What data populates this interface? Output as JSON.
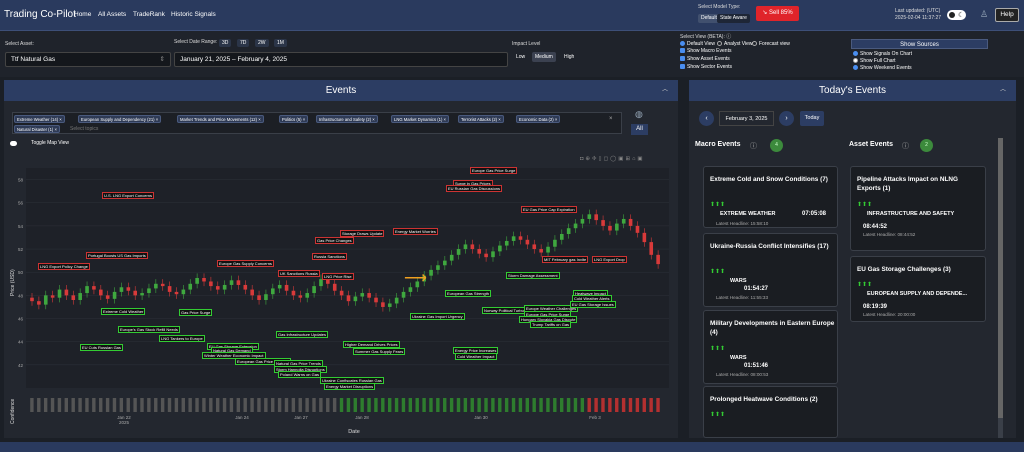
{
  "header": {
    "app_title": "Trading Co-Pilot",
    "nav": [
      "Home",
      "All Assets",
      "TradeRank",
      "Historic Signals"
    ],
    "model_label": "Select Model Type:",
    "model_default": "Default",
    "model_state": "State Aware",
    "sell_label": "Sell 85%",
    "updated_label": "Last updated: (UTC)",
    "updated_time": "2025-02-04 11:37:27",
    "help": "Help"
  },
  "controls": {
    "asset_label": "Select Asset:",
    "asset_value": "Ttf Natural Gas",
    "range_label": "Select Date Range:",
    "range_buttons": [
      "3D",
      "7D",
      "2W",
      "1M"
    ],
    "range_value": "January 21, 2025 – February 4, 2025",
    "impact_label": "Impact Level",
    "impact_options": [
      "Low",
      "Medium",
      "High"
    ],
    "view_label": "Select View (BETA):",
    "views": [
      "Default View",
      "Analyst View",
      "Forecast view"
    ],
    "show_checks": [
      "Show Macro Events",
      "Show Asset Events",
      "Show Sector Events"
    ],
    "sources_btn": "Show Sources",
    "source_opts": [
      "Show Signals On Chart",
      "Show Full Chart",
      "Show Weekend Events"
    ]
  },
  "events_panel": {
    "title": "Events",
    "all_btn": "All",
    "placeholder": "Select topics",
    "toggle_label": "Toggle Map View",
    "tags": [
      "Extreme Weather (14)",
      "European Supply and Dependency (21)",
      "Market Trends and Price Movements (12)",
      "Politics (5)",
      "Infrastructure and Safety (2)",
      "LNG Market Dynamics (1)",
      "Terrorist Attacks (2)",
      "Economic Data (2)",
      "Natural Disaster (1)"
    ]
  },
  "chart_data": {
    "type": "candlestick",
    "xlabel": "Date",
    "ylabel": "Price (USD)",
    "ylabel2": "Confidence",
    "x_ticks": [
      "Jan 22\n2025",
      "Jan 24",
      "Jan 27",
      "Jan 28",
      "Jan 30",
      "Feb 3"
    ],
    "y_ticks": [
      "58",
      "56",
      "54",
      "52",
      "50",
      "48",
      "46",
      "44",
      "42"
    ],
    "close": [
      47.5,
      47.2,
      48.0,
      47.8,
      48.5,
      48.0,
      47.6,
      48.2,
      48.8,
      48.5,
      48.0,
      47.7,
      48.3,
      48.7,
      48.4,
      48.0,
      48.2,
      48.6,
      49.0,
      48.8,
      48.3,
      48.1,
      48.5,
      49.0,
      49.5,
      49.2,
      48.8,
      48.5,
      48.9,
      49.3,
      48.9,
      48.5,
      48.0,
      47.6,
      48.1,
      48.6,
      48.9,
      48.4,
      48.0,
      47.8,
      48.2,
      48.8,
      49.4,
      49.0,
      48.4,
      48.0,
      47.5,
      47.9,
      48.2,
      47.8,
      47.4,
      47.0,
      47.3,
      47.8,
      48.3,
      48.7,
      49.2,
      49.7,
      50.2,
      50.6,
      51.0,
      51.5,
      52.0,
      52.4,
      52.0,
      51.6,
      51.3,
      51.8,
      52.3,
      52.7,
      53.1,
      52.8,
      52.4,
      52.0,
      51.7,
      52.2,
      52.8,
      53.3,
      53.8,
      54.2,
      54.6,
      55.0,
      54.5,
      54.0,
      53.6,
      54.2,
      54.6,
      54.0,
      53.4,
      52.6,
      51.5,
      50.7
    ],
    "annotations_red": [
      "Europe Gas Price Surge",
      "Surge in Gas Prices",
      "EU Russian Gas Discussions",
      "U.S. LNG Export Concerns",
      "EU Gas Price Cap Expiration",
      "Storage Draws Update",
      "Energy Market Worries",
      "Gas Price Changes",
      "Portugal Boosts US Gas Imports",
      "Europe Gas Supply Concerns",
      "Russia Sanctions",
      "LNG Export Policy Change",
      "UK Sanctions Russia",
      "LNG Price Rise",
      "MIT February gas Invite",
      "LNG Export Drop"
    ],
    "annotations_green": [
      "Extreme Cold Weather",
      "Gas Price Surge",
      "Europe's Gas Stock Refill Needs",
      "LNG Tankers to Europe",
      "EU Gas Storage Extension",
      "Natural Gas Demand",
      "Winter Weather Economic Impact",
      "European Gas Price Increase",
      "Natural Gas Price Trends",
      "Storm Hannolia Disruptions",
      "Poland Warns on Gas",
      "Gas Infrastructure Updates",
      "Ukraine Confiscates Russian Gas",
      "Energy Market Disruptions",
      "Higher Demand Drives Prices",
      "Summer Gas Supply Fears",
      "Ukraine Gas Import Urgency",
      "European Gas Strength",
      "Norway Political Turbulence",
      "Storm Damage Assessment",
      "Europe Weather Challenges",
      "Europe Gas Price Surge",
      "Hungary Slovakia Gas Dispute",
      "Trump Tariffs on Gas",
      "Heatwave Impact",
      "Cold Weather Alerts",
      "EU Gas Storage Issues",
      "Energy Price Increases",
      "Cold Weather Impact",
      "EU Cuts Russian Gas"
    ]
  },
  "today_panel": {
    "title": "Today's Events",
    "date": "February 3, 2025",
    "today_btn": "Today",
    "macro_label": "Macro Events",
    "macro_count": "4",
    "asset_label": "Asset Events",
    "asset_count": "2",
    "macro_cards": [
      {
        "title": "Extreme Cold and Snow Conditions (7)",
        "category": "EXTREME WEATHER",
        "time": "07:05:08",
        "headline": "Latest Headline: 15:58:10"
      },
      {
        "title": "Ukraine-Russia Conflict Intensifies (17)",
        "category": "WARS",
        "time": "01:54:27",
        "headline": "Latest Headline: 11:55:33"
      },
      {
        "title": "Military Developments in Eastern Europe (4)",
        "category": "WARS",
        "time": "01:51:46",
        "headline": "Latest Headline: 08:00:53"
      },
      {
        "title": "Prolonged Heatwave Conditions (2)",
        "category": "",
        "time": "",
        "headline": ""
      }
    ],
    "asset_cards": [
      {
        "title": "Pipeline Attacks Impact on NLNG Exports (1)",
        "category": "INFRASTRUCTURE AND SAFETY",
        "time": "08:44:52",
        "headline": "Latest Headline: 08:44:52"
      },
      {
        "title": "EU Gas Storage Challenges (3)",
        "category": "EUROPEAN SUPPLY AND DEPENDE...",
        "time": "08:19:39",
        "headline": "Latest Headline: 20:00:00"
      }
    ]
  }
}
